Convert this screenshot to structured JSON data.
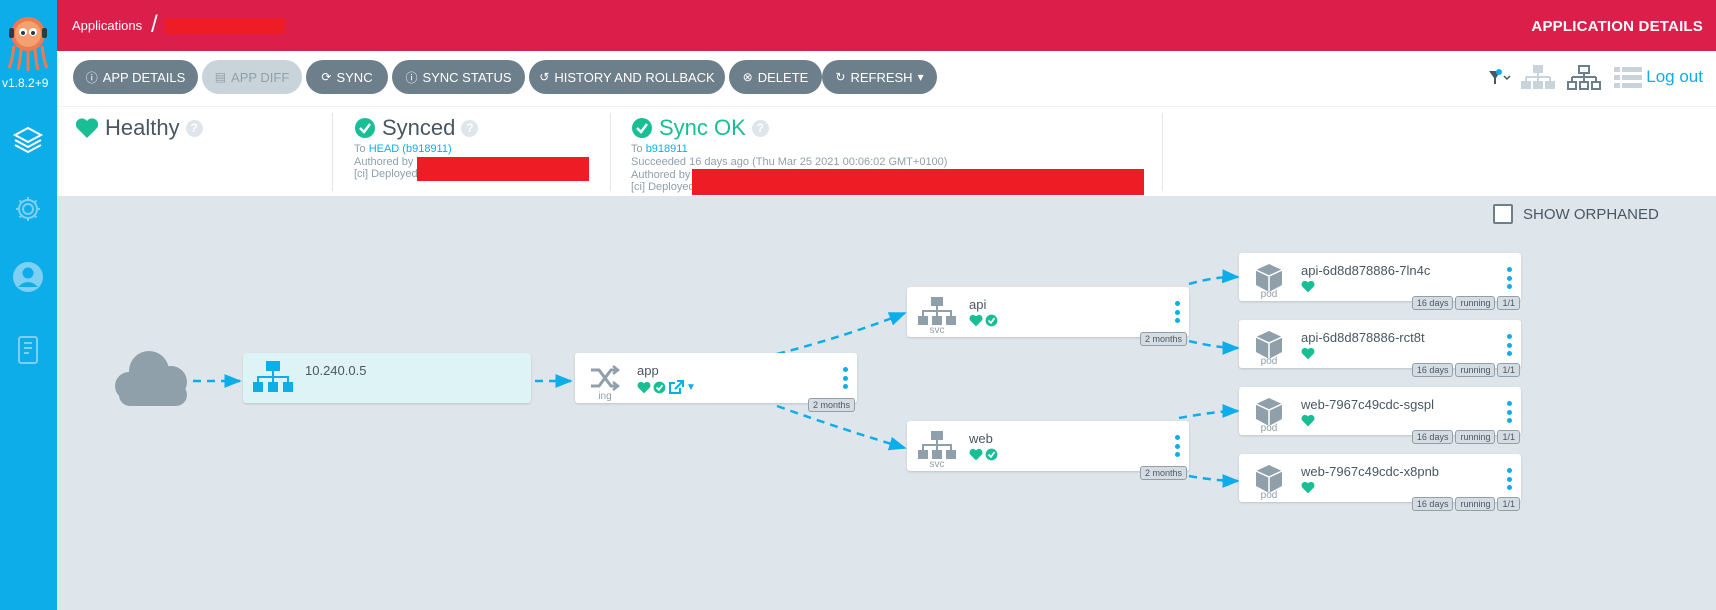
{
  "sidebar": {
    "version": "v1.8.2+9",
    "items": [
      {
        "name": "applications",
        "icon": "layers-icon"
      },
      {
        "name": "settings",
        "icon": "gear-icon"
      },
      {
        "name": "user-info",
        "icon": "user-icon"
      },
      {
        "name": "docs",
        "icon": "book-icon"
      }
    ]
  },
  "header": {
    "breadcrumb_root": "Applications",
    "breadcrumb_sep": "/",
    "title": "APPLICATION DETAILS"
  },
  "toolbar": {
    "buttons": [
      {
        "label": "APP DETAILS",
        "icon": "info-icon"
      },
      {
        "label": "APP DIFF",
        "icon": "file-icon",
        "disabled": true
      },
      {
        "label": "SYNC",
        "icon": "sync-icon"
      },
      {
        "label": "SYNC STATUS",
        "icon": "info-icon"
      },
      {
        "label": "HISTORY AND ROLLBACK",
        "icon": "history-icon"
      },
      {
        "label": "DELETE",
        "icon": "close-circle-icon"
      },
      {
        "label": "REFRESH",
        "icon": "refresh-icon"
      }
    ],
    "logout": "Log out"
  },
  "status": {
    "health": {
      "label": "Healthy",
      "help": "?"
    },
    "sync": {
      "label": "Synced",
      "help": "?",
      "to_prefix": "To",
      "to_ref": "HEAD (b918911)",
      "authored_by": "Authored by",
      "deployed": "[ci] Deployed"
    },
    "operation": {
      "label": "Sync OK",
      "help": "?",
      "to_prefix": "To",
      "to_ref": "b918911",
      "succeeded": "Succeeded 16 days ago (Thu Mar 25 2021 00:06:02 GMT+0100)",
      "authored_by": "Authored by",
      "deployed": "[ci] Deployed"
    }
  },
  "graph": {
    "show_orphaned": "SHOW ORPHANED",
    "ip_node": {
      "name": "10.240.0.5"
    },
    "ingress": {
      "name": "app",
      "kind": "ing",
      "age": "2 months"
    },
    "services": [
      {
        "name": "api",
        "kind": "svc",
        "age": "2 months"
      },
      {
        "name": "web",
        "kind": "svc",
        "age": "2 months"
      }
    ],
    "pods": [
      {
        "name": "api-6d8d878886-7ln4c",
        "kind": "pod",
        "age": "16 days",
        "state": "running",
        "ready": "1/1"
      },
      {
        "name": "api-6d8d878886-rct8t",
        "kind": "pod",
        "age": "16 days",
        "state": "running",
        "ready": "1/1"
      },
      {
        "name": "web-7967c49cdc-sgspl",
        "kind": "pod",
        "age": "16 days",
        "state": "running",
        "ready": "1/1"
      },
      {
        "name": "web-7967c49cdc-x8pnb",
        "kind": "pod",
        "age": "16 days",
        "state": "running",
        "ready": "1/1"
      }
    ]
  },
  "colors": {
    "sidebar": "#0dadea",
    "header": "#dc1e4a",
    "healthy": "#18be94",
    "button": "#6d7f8b",
    "edge": "#0dadea"
  }
}
